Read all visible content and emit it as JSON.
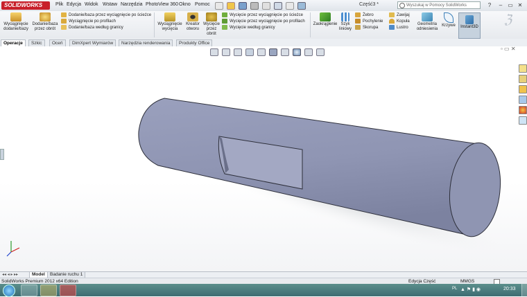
{
  "app": {
    "logo": "SOLIDWORKS",
    "title": "Część3 *"
  },
  "menu": [
    "Plik",
    "Edycja",
    "Widok",
    "Wstaw",
    "Narzędzia",
    "PhotoView 360",
    "Okno",
    "Pomoc"
  ],
  "search": {
    "placeholder": "Wyszukaj w Pomocy SolidWorks"
  },
  "ribbon": {
    "extrude_boss": "Wyciągnięcie dodanie/bazy",
    "revolve_boss": "Dodanie/baza przez obrót",
    "sweep_boss": "Dodanie/baza przez wyciągnięcie po ścieżce",
    "loft_boss": "Wyciągnięcie po profilach",
    "boundary_boss": "Dodanie/baza według granicy",
    "extrude_cut": "Wyciągnięcie wycięcia",
    "hole_wizard": "Kreator otworu",
    "revolve_cut": "Wycięcie przez obrót",
    "sweep_cut": "Wycięcie przez wyciągnięcie po ścieżce",
    "loft_cut": "Wycięcie przez wyciągnięcie po profilach",
    "boundary_cut": "Wycięcie według granicy",
    "fillet": "Zaokrąglenie",
    "linear_pattern": "Szyk liniowy",
    "rib": "Żebro",
    "draft": "Pochylenie",
    "shell": "Skorupa",
    "wrap": "Zawijaj",
    "dome": "Kopuła",
    "mirror": "Lustro",
    "ref_geometry": "Geometria odniesienia",
    "curves": "Krzywe",
    "instant3d": "Instant3D"
  },
  "tabs": [
    "Operacje",
    "Szkic",
    "Oceń",
    "DimXpert Wymiarów",
    "Narzędzia renderowania",
    "Produkty Office"
  ],
  "model_tabs": [
    "Model",
    "Badanie ruchu 1"
  ],
  "status": {
    "left": "SolidWorks Premium 2012 x64 Edition",
    "mode": "Edycja Część",
    "units": "MMGS"
  },
  "taskbar": {
    "lang": "PL",
    "clock": "20:33"
  },
  "colors": {
    "part": "#8f95b3",
    "logo": "#c8202a",
    "taskbar": "#4a7c80"
  }
}
